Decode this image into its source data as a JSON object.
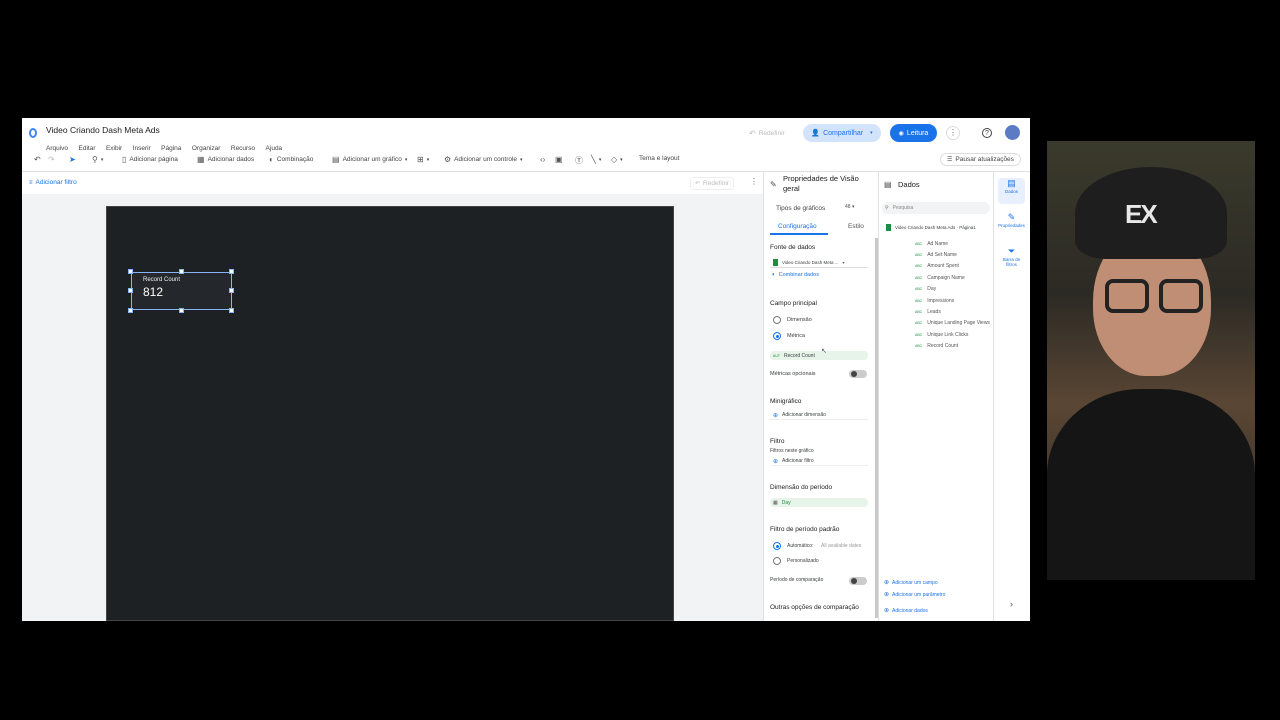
{
  "doc": {
    "title": "Video Criando Dash Meta Ads"
  },
  "menu": [
    "Arquivo",
    "Editar",
    "Exibir",
    "Inserir",
    "Página",
    "Organizar",
    "Recurso",
    "Ajuda"
  ],
  "header": {
    "reset": "Redefinir",
    "share": "Compartilhar",
    "read": "Leitura"
  },
  "toolbar": {
    "add_page": "Adicionar página",
    "add_data": "Adicionar dados",
    "blend": "Combinação",
    "add_chart": "Adicionar um gráfico",
    "add_control": "Adicionar um controle",
    "theme": "Tema e layout",
    "pause": "Pausar atualizações"
  },
  "filterbar": {
    "add_filter": "Adicionar filtro",
    "reset": "Redefinir"
  },
  "scorecard": {
    "label": "Record Count",
    "value": "812"
  },
  "props": {
    "title": "Propriedades de Visão geral",
    "chart_types": "Tipos de gráficos",
    "tab_config": "Configuração",
    "tab_style": "Estilo",
    "data_source_h": "Fonte de dados",
    "data_source": "Video Criando Dash Meta ...",
    "blend": "Combinar dados",
    "main_field_h": "Campo principal",
    "dimension": "Dimensão",
    "metric": "Métrica",
    "metric_chip": "Record Count",
    "opt_metrics": "Métricas opcionais",
    "minichart_h": "Minigráfico",
    "add_dimension": "Adicionar dimensão",
    "filter_h": "Filtro",
    "filters_in_chart": "Filtros neste gráfico",
    "add_filter": "Adicionar filtro",
    "period_dim_h": "Dimensão do período",
    "period_dim": "Day",
    "default_period_h": "Filtro de período padrão",
    "automatic": "Automático:",
    "all_dates": "All available dates",
    "custom": "Personalizado",
    "comparison": "Período de comparação",
    "other_options": "Outras opções de comparação"
  },
  "data_panel": {
    "title": "Dados",
    "search": "Pesquisa",
    "source": "Video Criando Dash Meta Ads · Página1",
    "fields": [
      "Ad Name",
      "Ad Set Name",
      "Amount Spent",
      "Campaign Name",
      "Day",
      "Impressions",
      "Leads",
      "Unique Landing Page Views",
      "Unique Link Clicks",
      "Record Count"
    ],
    "add_field": "Adicionar um campo",
    "add_param": "Adicionar um parâmetro",
    "add_data": "Adicionar dados"
  },
  "rail": {
    "data": "Dados",
    "props": "Propriedades",
    "filters": "Barra de filtros"
  },
  "webcam": {
    "logo": "EX"
  }
}
